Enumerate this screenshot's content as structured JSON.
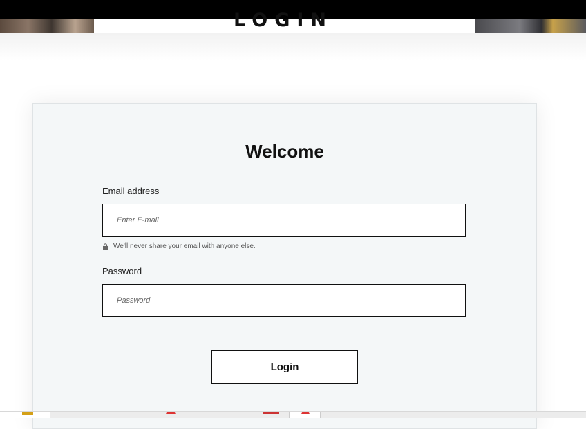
{
  "header": {
    "title": "LOGIN"
  },
  "card": {
    "heading": "Welcome",
    "email": {
      "label": "Email address",
      "placeholder": "Enter E-mail",
      "value": "",
      "help": "We'll never share your email with anyone else."
    },
    "password": {
      "label": "Password",
      "placeholder": "Password",
      "value": ""
    },
    "submit_label": "Login"
  },
  "icons": {
    "help_icon": "lock-icon"
  },
  "colors": {
    "card_background": "#f4f7f8",
    "top_bar": "#000000",
    "border": "#111111"
  }
}
